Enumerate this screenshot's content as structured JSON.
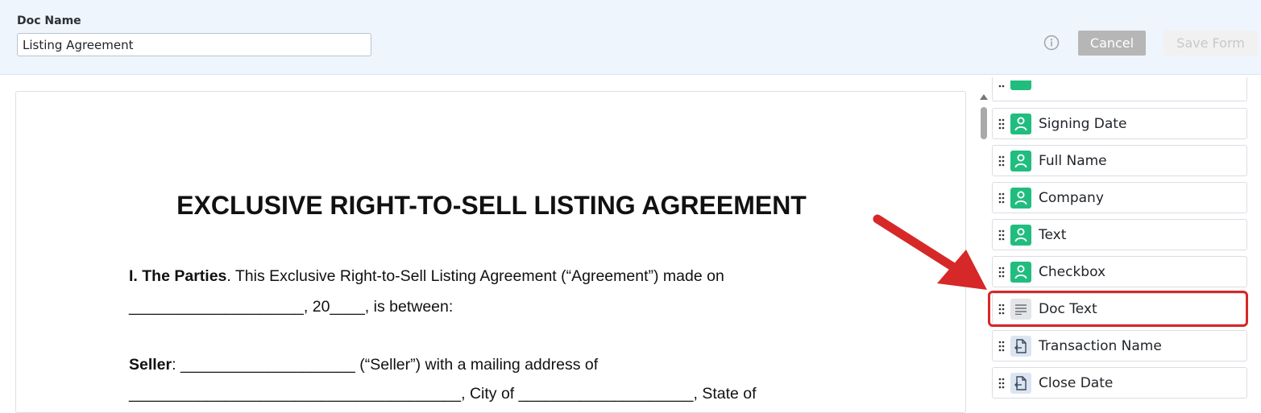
{
  "header": {
    "doc_name_label": "Doc Name",
    "doc_name_value": "Listing Agreement",
    "cancel_label": "Cancel",
    "save_label": "Save Form"
  },
  "document": {
    "title": "EXCLUSIVE RIGHT-TO-SELL LISTING AGREEMENT",
    "line1_bold": "I. The Parties",
    "line1_rest": ". This Exclusive Right-to-Sell Listing Agreement (“Agreement”) made on",
    "line2": "____________________, 20____, is between:",
    "line3_bold": "Seller",
    "line3_rest": ": ____________________ (“Seller”) with a mailing address of",
    "line4": "______________________________________, City of ____________________, State of"
  },
  "fields": [
    {
      "label": "Signing Date",
      "icon": "person-icon",
      "color": "#21bd7f"
    },
    {
      "label": "Full Name",
      "icon": "person-icon",
      "color": "#21bd7f"
    },
    {
      "label": "Company",
      "icon": "person-icon",
      "color": "#21bd7f"
    },
    {
      "label": "Text",
      "icon": "person-icon",
      "color": "#21bd7f"
    },
    {
      "label": "Checkbox",
      "icon": "person-icon",
      "color": "#21bd7f"
    },
    {
      "label": "Doc Text",
      "icon": "text-lines-icon",
      "color": "#e3e5e8"
    },
    {
      "label": "Transaction Name",
      "icon": "document-import-icon",
      "color": "#dbe5f2"
    },
    {
      "label": "Close Date",
      "icon": "document-import-icon",
      "color": "#dbe5f2"
    }
  ],
  "accent": "#d62828"
}
